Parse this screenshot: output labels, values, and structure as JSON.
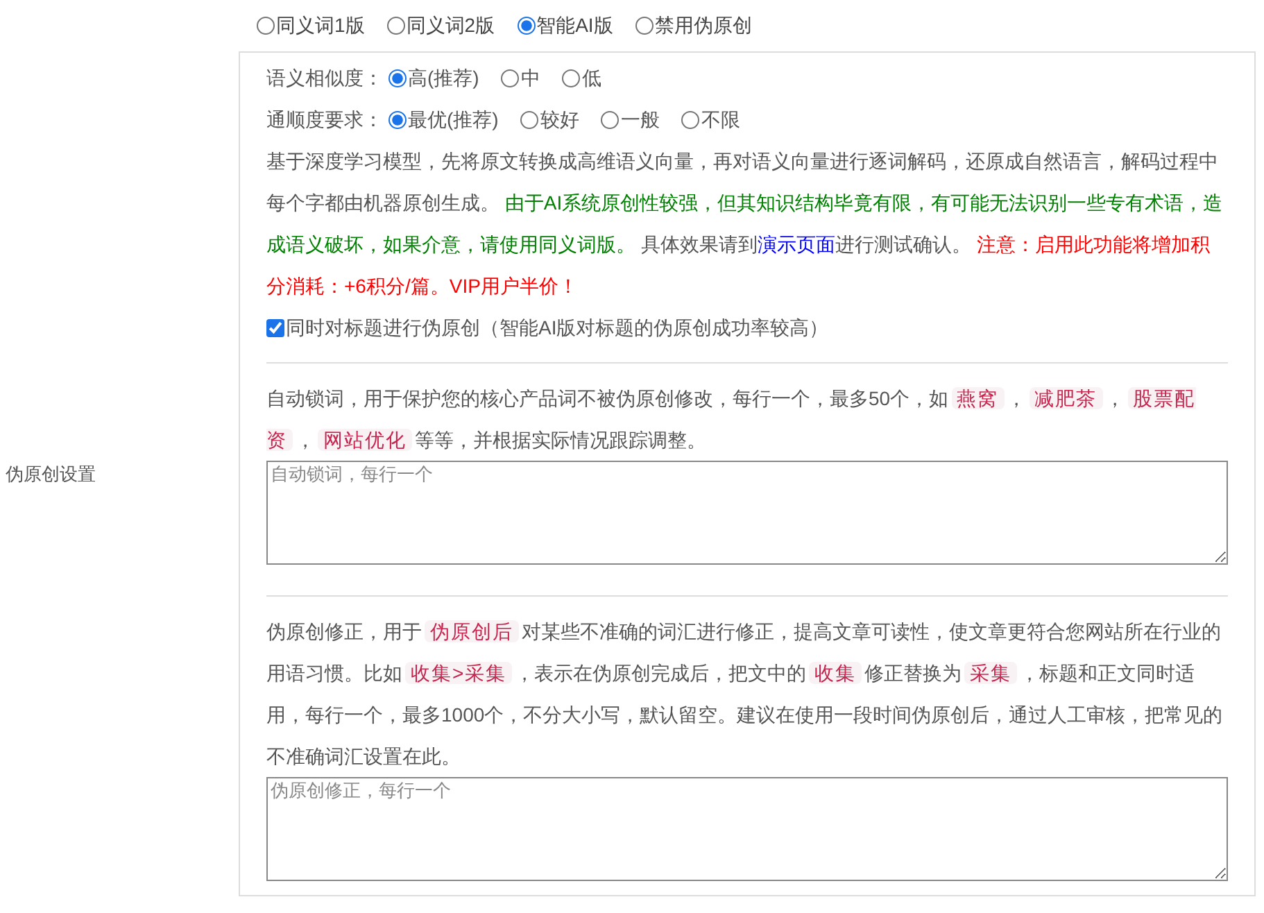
{
  "mode_options": [
    {
      "label": "同义词1版",
      "selected": false
    },
    {
      "label": "同义词2版",
      "selected": false
    },
    {
      "label": "智能AI版",
      "selected": true
    },
    {
      "label": "禁用伪原创",
      "selected": false
    }
  ],
  "similarity": {
    "label": "语义相似度：",
    "options": [
      {
        "label": "高(推荐)",
        "selected": true
      },
      {
        "label": "中",
        "selected": false
      },
      {
        "label": "低",
        "selected": false
      }
    ]
  },
  "fluency": {
    "label": "通顺度要求：",
    "options": [
      {
        "label": "最优(推荐)",
        "selected": true
      },
      {
        "label": "较好",
        "selected": false
      },
      {
        "label": "一般",
        "selected": false
      },
      {
        "label": "不限",
        "selected": false
      }
    ]
  },
  "ai_description": [
    {
      "kind": "text",
      "text": "基于深度学习模型，先将原文转换成高维语义向量，再对语义向量进行逐词解码，还原成自然语言，解码过程中每个字都由机器原创生成。 "
    },
    {
      "kind": "accent",
      "text": "由于AI系统原创性较强，但其知识结构毕竟有限，有可能无法识别一些专有术语，造成语义破坏，如果介意，请使用同义词版。"
    },
    {
      "kind": "text",
      "text": " 具体效果请到"
    },
    {
      "kind": "link",
      "text": "演示页面"
    },
    {
      "kind": "text",
      "text": "进行测试确认。 "
    },
    {
      "kind": "warning",
      "text": "注意：启用此功能将增加积分消耗：+6积分/篇。VIP用户半价！"
    }
  ],
  "title_option": {
    "label": "同时对标题进行伪原创（智能AI版对标题的伪原创成功率较高）",
    "checked": true
  },
  "setting_label": "伪原创设置",
  "lock_words": {
    "description": [
      {
        "kind": "text",
        "text": "自动锁词，用于保护您的核心产品词不被伪原创修改，每行一个，最多50个，如"
      },
      {
        "kind": "code",
        "text": "燕窝"
      },
      {
        "kind": "text",
        "text": "，"
      },
      {
        "kind": "code",
        "text": "减肥茶"
      },
      {
        "kind": "text",
        "text": "，"
      },
      {
        "kind": "code",
        "text": "股票配资"
      },
      {
        "kind": "text",
        "text": "，"
      },
      {
        "kind": "code",
        "text": "网站优化"
      },
      {
        "kind": "text",
        "text": "等等，并根据实际情况跟踪调整。"
      }
    ],
    "placeholder": "自动锁词，每行一个"
  },
  "correction": {
    "description": [
      {
        "kind": "text",
        "text": "伪原创修正，用于"
      },
      {
        "kind": "code",
        "text": "伪原创后"
      },
      {
        "kind": "text",
        "text": "对某些不准确的词汇进行修正，提高文章可读性，使文章更符合您网站所在行业的用语习惯。比如"
      },
      {
        "kind": "code",
        "text": "收集>采集"
      },
      {
        "kind": "text",
        "text": "，表示在伪原创完成后，把文中的"
      },
      {
        "kind": "code",
        "text": "收集"
      },
      {
        "kind": "text",
        "text": "修正替换为"
      },
      {
        "kind": "code",
        "text": "采集"
      },
      {
        "kind": "text",
        "text": "，标题和正文同时适用，每行一个，最多1000个，不分大小写，默认留空。建议在使用一段时间伪原创后，通过人工审核，把常见的不准确词汇设置在此。"
      }
    ],
    "placeholder": "伪原创修正，每行一个"
  }
}
